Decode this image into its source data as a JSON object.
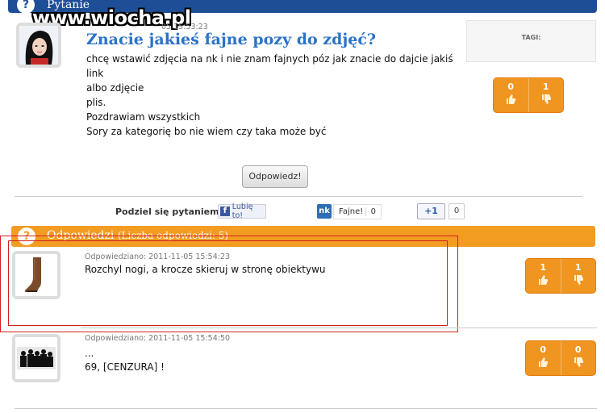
{
  "header": {
    "icon": "question-mark",
    "title": "Pytanie",
    "watermark": "www.wiocha.pl"
  },
  "question": {
    "date": "05 15:53:23",
    "title": "Znacie jakieś fajne pozy do zdjęć?",
    "lines": [
      "chcę wstawić zdjęcia na nk i nie znam fajnych póz jak znacie do dajcie jakiś link",
      "albo zdjęcie",
      "plis.",
      "Pozdrawiam wszystkich",
      "Sory za kategorię bo nie wiem czy taka może być"
    ],
    "votes": {
      "up": "0",
      "down": "1"
    },
    "tags_label": "TAGI:",
    "reply_button": "Odpowiedz!"
  },
  "share": {
    "label": "Podziel się pytaniem na:",
    "fb_like": "Lubię to!",
    "nk_label": "Fajne!",
    "nk_count": "0",
    "gplus_label": "+1",
    "gplus_count": "0"
  },
  "answers_header": {
    "title": "Odpowiedzi",
    "count_text": "(Liczba odpowiedzi: 5)"
  },
  "answers": [
    {
      "meta": "Odpowiedziano: 2011-11-05 15:54:23",
      "lines": [
        "Rozchyl nogi, a krocze skieruj w stronę obiektywu"
      ],
      "up": "1",
      "down": "1"
    },
    {
      "meta": "Odpowiedziano: 2011-11-05 15:54:50",
      "lines": [
        "...",
        "69, [CENZURA] !"
      ],
      "up": "0",
      "down": "0"
    }
  ],
  "colors": {
    "header_blue": "#1e4e96",
    "orange": "#f29c22",
    "title_blue": "#2a72c8",
    "highlight_red": "#d41f1f"
  }
}
